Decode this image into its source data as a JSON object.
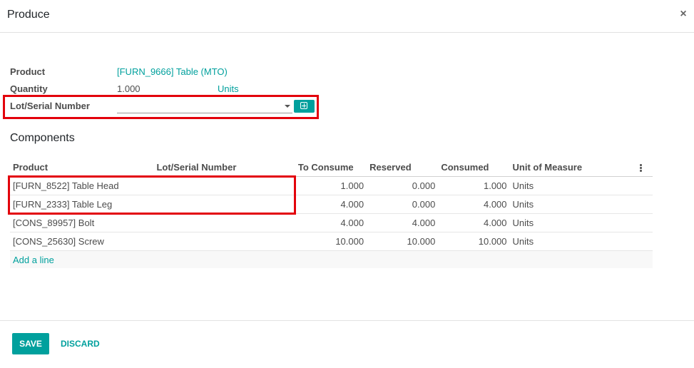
{
  "dialog": {
    "title": "Produce"
  },
  "form": {
    "product_label": "Product",
    "product_value": "[FURN_9666] Table (MTO)",
    "quantity_label": "Quantity",
    "quantity_value": "1.000",
    "quantity_uom": "Units",
    "lot_label": "Lot/Serial Number",
    "lot_value": ""
  },
  "components": {
    "title": "Components",
    "columns": {
      "product": "Product",
      "lot": "Lot/Serial Number",
      "to_consume": "To Consume",
      "reserved": "Reserved",
      "consumed": "Consumed",
      "uom": "Unit of Measure"
    },
    "rows": [
      {
        "product": "[FURN_8522] Table Head",
        "lot": "",
        "to_consume": "1.000",
        "reserved": "0.000",
        "consumed": "1.000",
        "uom": "Units"
      },
      {
        "product": "[FURN_2333] Table Leg",
        "lot": "",
        "to_consume": "4.000",
        "reserved": "0.000",
        "consumed": "4.000",
        "uom": "Units"
      },
      {
        "product": "[CONS_89957] Bolt",
        "lot": "",
        "to_consume": "4.000",
        "reserved": "4.000",
        "consumed": "4.000",
        "uom": "Units"
      },
      {
        "product": "[CONS_25630] Screw",
        "lot": "",
        "to_consume": "10.000",
        "reserved": "10.000",
        "consumed": "10.000",
        "uom": "Units"
      }
    ],
    "add_line": "Add a line"
  },
  "footer": {
    "save_label": "SAVE",
    "discard_label": "DISCARD"
  },
  "colors": {
    "accent": "#00a09d",
    "highlight": "#e3000b"
  },
  "icons": {
    "close": "close-icon",
    "create": "plus-square-icon",
    "options": "kebab-vertical-icon",
    "dropdown": "caret-down-icon"
  }
}
